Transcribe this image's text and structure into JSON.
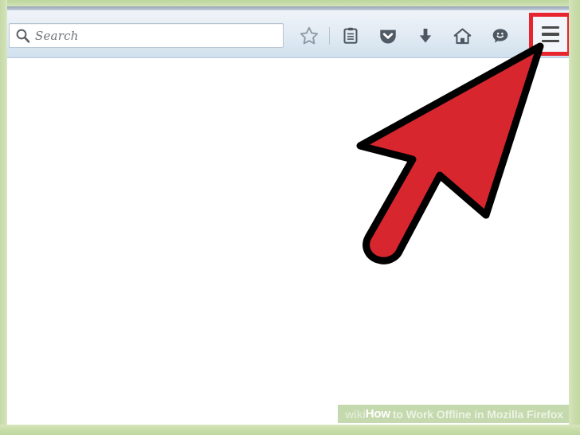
{
  "browser": {
    "name": "Mozilla Firefox",
    "search": {
      "placeholder": "Search",
      "value": "",
      "icon": "search-icon"
    },
    "toolbar_icons": [
      {
        "name": "bookmark-star-icon",
        "label": "Bookmark this page"
      },
      {
        "name": "reading-list-icon",
        "label": "Reading list"
      },
      {
        "name": "pocket-icon",
        "label": "Save to Pocket"
      },
      {
        "name": "downloads-icon",
        "label": "Downloads"
      },
      {
        "name": "home-icon",
        "label": "Home"
      },
      {
        "name": "hello-smiley-icon",
        "label": "Firefox Hello"
      }
    ],
    "menu_button": {
      "name": "hamburger-menu-icon",
      "label": "Open menu",
      "highlighted": true,
      "highlight_color": "#e8242e"
    }
  },
  "annotation": {
    "cursor": {
      "name": "red-arrow-cursor",
      "color": "#d8262f",
      "outline_color": "#000000",
      "points_to": "hamburger-menu-icon"
    }
  },
  "watermark": {
    "wiki": "wiki",
    "how": "How",
    "rest": "to Work Offline in Mozilla Firefox",
    "full_text": "wikiHow to Work Offline in Mozilla Firefox"
  },
  "colors": {
    "frame_green": "#c3d9a4",
    "toolbar_top": "#eef3f8",
    "toolbar_bottom": "#cfe0ee",
    "icon_gray": "#5b6671",
    "highlight_red": "#e8242e",
    "cursor_red": "#d8262f",
    "page_background": "#ffffff"
  }
}
